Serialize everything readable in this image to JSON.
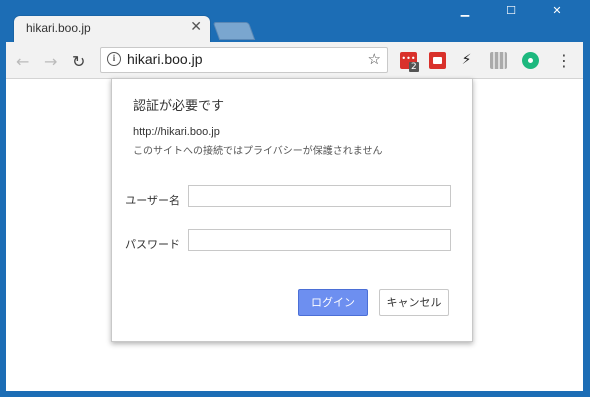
{
  "tab": {
    "title": "hikari.boo.jp"
  },
  "toolbar": {
    "url": "hikari.boo.jp",
    "extension_badge": "2"
  },
  "dialog": {
    "title": "認証が必要です",
    "url": "http://hikari.boo.jp",
    "warning": "このサイトへの接続ではプライバシーが保護されません",
    "username_label": "ユーザー名",
    "username_value": "",
    "password_label": "パスワード",
    "password_value": "",
    "login_label": "ログイン",
    "cancel_label": "キャンセル"
  },
  "colors": {
    "frame": "#1c6db5",
    "login_button": "#6d8ff0"
  },
  "icons": [
    "info-icon",
    "star-icon",
    "reload-icon",
    "back-icon",
    "forward-icon",
    "menu-icon"
  ]
}
